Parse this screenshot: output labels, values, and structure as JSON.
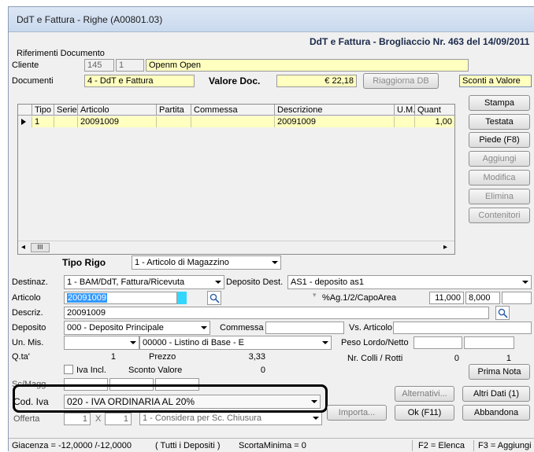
{
  "window": {
    "title": "DdT e Fattura -  Righe  (A00801.03)"
  },
  "header": {
    "subtitle": "DdT e Fattura  - Brogliaccio Nr. 463 del 14/09/2011"
  },
  "riferimenti": {
    "group_label": "Riferimenti Documento",
    "cliente_label": "Cliente",
    "cliente_code": "145",
    "cliente_sub": "1",
    "cliente_name": "Openm Open",
    "documenti_label": "Documenti",
    "documenti_value": "4 - DdT e Fattura",
    "valore_doc_label": "Valore Doc.",
    "valore_doc_value": "€ 22,18",
    "riaggiorna_label": "Riaggiorna DB",
    "sconti_label": "Sconti a Valore"
  },
  "grid": {
    "columns": [
      "Tipo",
      "Serie",
      "Articolo",
      "Partita",
      "Commessa",
      "Descrizione",
      "U.M.",
      "Quant"
    ],
    "rows": [
      {
        "tipo": "1",
        "serie": "",
        "articolo": "20091009",
        "partita": "",
        "commessa": "",
        "descrizione": "20091009",
        "um": "",
        "quant": "1,00"
      }
    ],
    "scroll_thumb": "III"
  },
  "right_buttons": {
    "stampa": "Stampa",
    "testata": "Testata",
    "piede": "Piede (F8)",
    "aggiungi": "Aggiungi",
    "modifica": "Modifica",
    "elimina": "Elimina",
    "contenitori": "Contenitori"
  },
  "form": {
    "tipo_rigo_label": "Tipo Rigo",
    "tipo_rigo_value": "1 - Articolo di Magazzino",
    "destinaz_label": "Destinaz.",
    "destinaz_value": "1 - BAM/DdT, Fattura/Ricevuta",
    "deposito_dest_label": "Deposito Dest.",
    "deposito_dest_value": "AS1 - deposito as1",
    "articolo_label": "Articolo",
    "articolo_value": "20091009",
    "ag_label": "%Ag.1/2/CapoArea",
    "ag1_value": "11,000",
    "ag2_value": "8,000",
    "descriz_label": "Descriz.",
    "descriz_value": "20091009",
    "deposito_label": "Deposito",
    "deposito_value": "000 - Deposito Principale",
    "commessa_label": "Commessa",
    "vs_articolo_label": "Vs. Articolo",
    "unmis_label": "Un. Mis.",
    "listino_value": "00000 - Listino di Base - E",
    "peso_label": "Peso Lordo/Netto",
    "qta_label": "Q.ta'",
    "qta_value": "1",
    "prezzo_label": "Prezzo",
    "prezzo_value": "3,33",
    "colli_label": "Nr. Colli / Rotti",
    "colli_value": "0",
    "rotti_value": "1",
    "iva_incl_label": "Iva Incl.",
    "sconto_valore_label": "Sconto Valore",
    "sconto_valore_value": "0",
    "scmagg_label": "Sc/Magg.",
    "cod_iva_label": "Cod. Iva",
    "cod_iva_value": "020 - IVA ORDINARIA AL 20%",
    "offerta_label": "Offerta",
    "offerta_a": "1",
    "offerta_x": "X",
    "offerta_b": "1",
    "offerta_select": "1 - Considera per Sc. Chiusura"
  },
  "bottom_buttons": {
    "prima_nota": "Prima Nota",
    "alternativi": "Alternativi...",
    "altri_dati": "Altri Dati (1)",
    "importa": "Importa...",
    "ok": "Ok (F11)",
    "abbandona": "Abbandona"
  },
  "status_bar": {
    "giacenza": "Giacenza = -12,0000 /-12,0000",
    "depositi": "( Tutti i Depositi )",
    "scorta": "ScortaMinima = 0",
    "f2": "F2 = Elenca",
    "f3": "F3 = Aggiungi"
  }
}
